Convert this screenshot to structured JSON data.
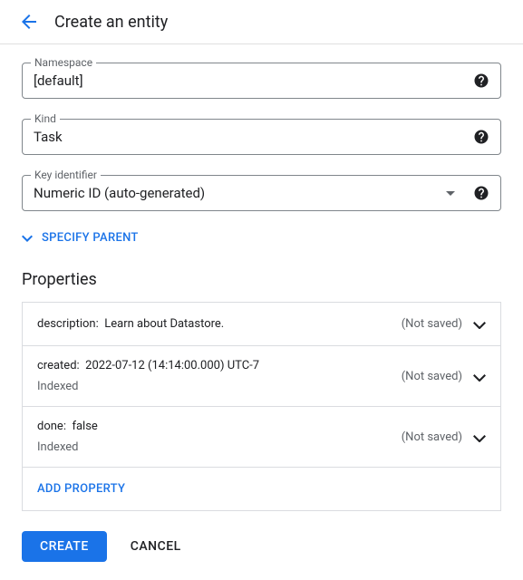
{
  "header": {
    "title": "Create an entity"
  },
  "fields": {
    "namespace": {
      "label": "Namespace",
      "value": "[default]"
    },
    "kind": {
      "label": "Kind",
      "value": "Task"
    },
    "key_identifier": {
      "label": "Key identifier",
      "value": "Numeric ID (auto-generated)"
    }
  },
  "specify_parent_label": "SPECIFY PARENT",
  "properties_section_title": "Properties",
  "properties": [
    {
      "name": "description",
      "value": "Learn about Datastore.",
      "indexed_label": "",
      "status": "(Not saved)"
    },
    {
      "name": "created",
      "value": "2022-07-12 (14:14:00.000) UTC-7",
      "indexed_label": "Indexed",
      "status": "(Not saved)"
    },
    {
      "name": "done",
      "value": "false",
      "indexed_label": "Indexed",
      "status": "(Not saved)"
    }
  ],
  "add_property_label": "ADD PROPERTY",
  "actions": {
    "create": "CREATE",
    "cancel": "CANCEL"
  }
}
